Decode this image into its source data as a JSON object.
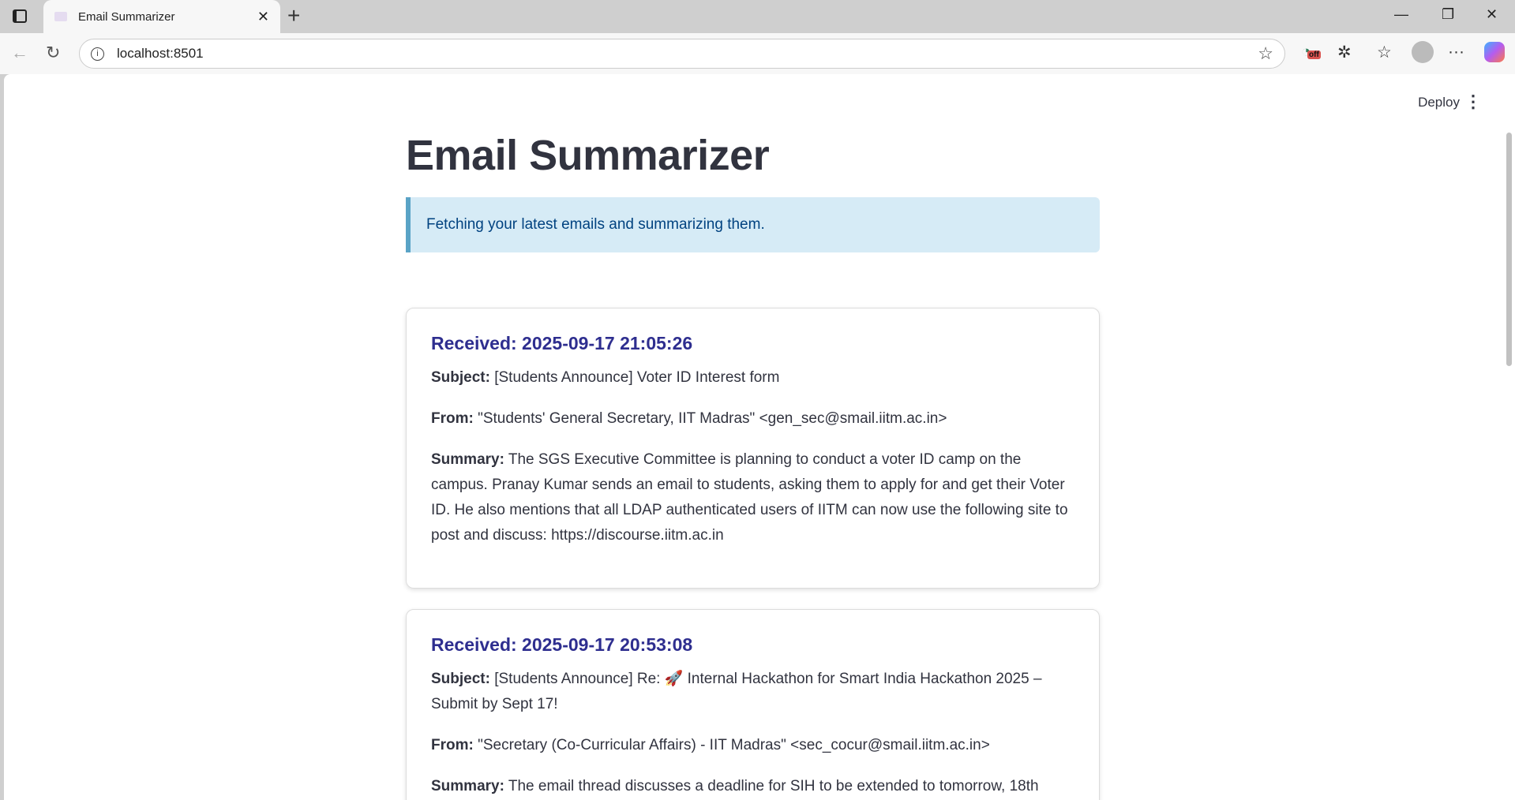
{
  "browser": {
    "tab_title": "Email Summarizer",
    "url": "localhost:8501",
    "ext_badge": "off"
  },
  "app": {
    "deploy_label": "Deploy",
    "title": "Email Summarizer",
    "info": "Fetching your latest emails and summarizing them."
  },
  "labels": {
    "subject": "Subject:",
    "from": "From:",
    "summary": "Summary:"
  },
  "emails": [
    {
      "received": "Received: 2025-09-17 21:05:26",
      "subject": "[Students Announce] Voter ID Interest form",
      "from": "\"Students' General Secretary, IIT Madras\" <gen_sec@smail.iitm.ac.in>",
      "summary": "The SGS Executive Committee is planning to conduct a voter ID camp on the campus. Pranay Kumar sends an email to students, asking them to apply for and get their Voter ID. He also mentions that all LDAP authenticated users of IITM can now use the following site to post and discuss: https://discourse.iitm.ac.in"
    },
    {
      "received": "Received: 2025-09-17 20:53:08",
      "subject": "[Students Announce] Re: 🚀 Internal Hackathon for Smart India Hackathon 2025 – Submit by Sept 17!",
      "from": "\"Secretary (Co-Curricular Affairs) - IIT Madras\" <sec_cocur@smail.iitm.ac.in>",
      "summary": "The email thread discusses a deadline for SIH to be extended to tomorrow, 18th"
    }
  ]
}
